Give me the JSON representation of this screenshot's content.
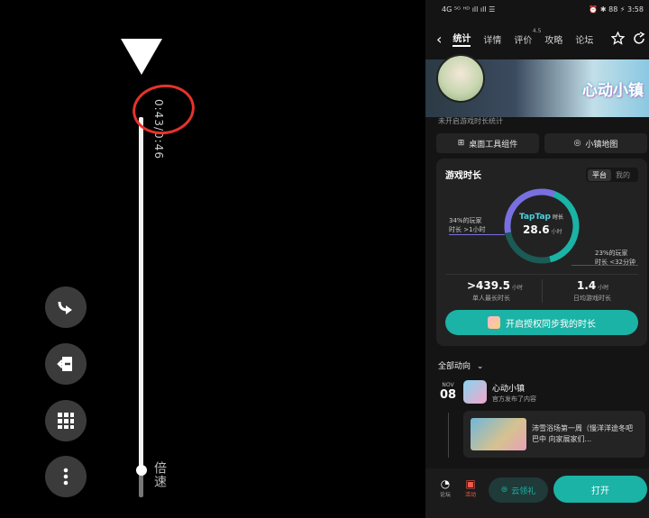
{
  "player": {
    "time_current": "0:43",
    "time_separator": "/",
    "time_total": "0:46",
    "progress_fraction": 0.93,
    "speed_label": "倍速",
    "controls": [
      "forward-icon",
      "exit-icon",
      "grid-icon",
      "more-icon"
    ],
    "annotation_color": "#e5332a"
  },
  "status": {
    "left": "4G ⁵ᴳ ᴴᴰ ıll ıll ☰",
    "right": "⏰ ✱ 88 ⚡ 3:58"
  },
  "tabs": [
    {
      "label": "统计",
      "active": true
    },
    {
      "label": "详情",
      "active": false
    },
    {
      "label": "评价",
      "active": false,
      "badge": "4.5"
    },
    {
      "label": "攻略",
      "active": false
    },
    {
      "label": "论坛",
      "active": false
    }
  ],
  "game": {
    "logo_text": "心动小镇",
    "tracking_note": "未开启游戏时长统计",
    "widget_button": "桌面工具组件",
    "map_button": "小镇地图"
  },
  "stats": {
    "title": "游戏时长",
    "seg_platform": "平台",
    "seg_mine": "我的",
    "brand": "TapTap",
    "brand_suffix": "时长",
    "total_hours": "28.6",
    "total_unit": "小时",
    "left_note_line1": "34%的玩家",
    "left_note_line2": "时长 >1小时",
    "right_note_line1": "23%的玩家",
    "right_note_line2": "时长 <32分钟",
    "stat1_value": ">439.5",
    "stat1_unit": "小时",
    "stat1_label": "单人最长时长",
    "stat2_value": "1.4",
    "stat2_unit": "小时",
    "stat2_label": "日均游戏时长",
    "sync_button": "开启授权同步我的时长",
    "ring_purple_fraction": 0.34,
    "ring_teal_fraction": 0.43
  },
  "feed": {
    "filter_label": "全部动向",
    "date_month": "NOV",
    "date_day": "08",
    "item_title": "心动小镇",
    "item_subtitle": "官方发布了内容",
    "post_text": "沛雪浴场第一周（慢洋洋途冬吧 巴中 向家展家们..."
  },
  "bottom": {
    "forum_label": "论坛",
    "gift_label": "活动",
    "download_label": "云领礼",
    "open_label": "打开"
  },
  "colors": {
    "accent_teal": "#1ab3a6",
    "ring_purple": "#7a6fe0",
    "card_bg": "#222222"
  }
}
